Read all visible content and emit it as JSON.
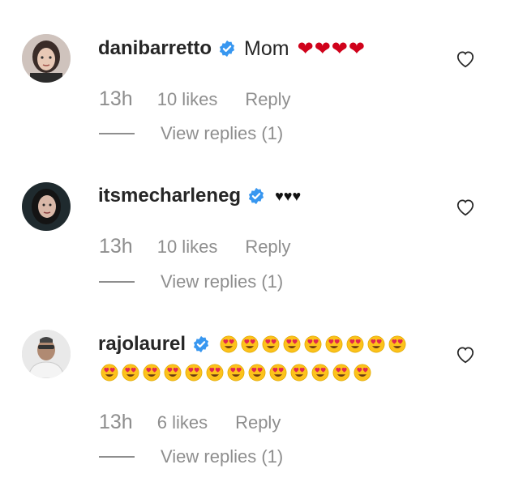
{
  "comments": [
    {
      "username": "dani​barretto",
      "text": "Mom",
      "reaction": "hearts-red",
      "hearts": [
        "❤",
        "❤",
        "❤",
        "❤"
      ],
      "time": "13h",
      "likes": "10 likes",
      "reply_label": "Reply",
      "view_replies": "View replies (1)"
    },
    {
      "username": "itsmecharleneg",
      "text": "",
      "reaction": "hearts-black",
      "hearts": [
        "♥",
        "♥",
        "♥"
      ],
      "time": "13h",
      "likes": "10 likes",
      "reply_label": "Reply",
      "view_replies": "View replies (1)"
    },
    {
      "username": "rajolaurel",
      "text": "",
      "reaction": "heart-eyes",
      "emoji_name": "heart-eyes-emoji",
      "emoji_line1_count": 9,
      "emoji_line2_count": 13,
      "time": "13h",
      "likes": "6 likes",
      "reply_label": "Reply",
      "view_replies": "View replies (1)"
    }
  ],
  "colors": {
    "username": "#262626",
    "meta": "#8e8e8e",
    "verified": "#3897f0",
    "red_heart": "#d0021b"
  },
  "icons": {
    "verified": "verified-badge-icon",
    "like": "heart-outline-icon"
  }
}
